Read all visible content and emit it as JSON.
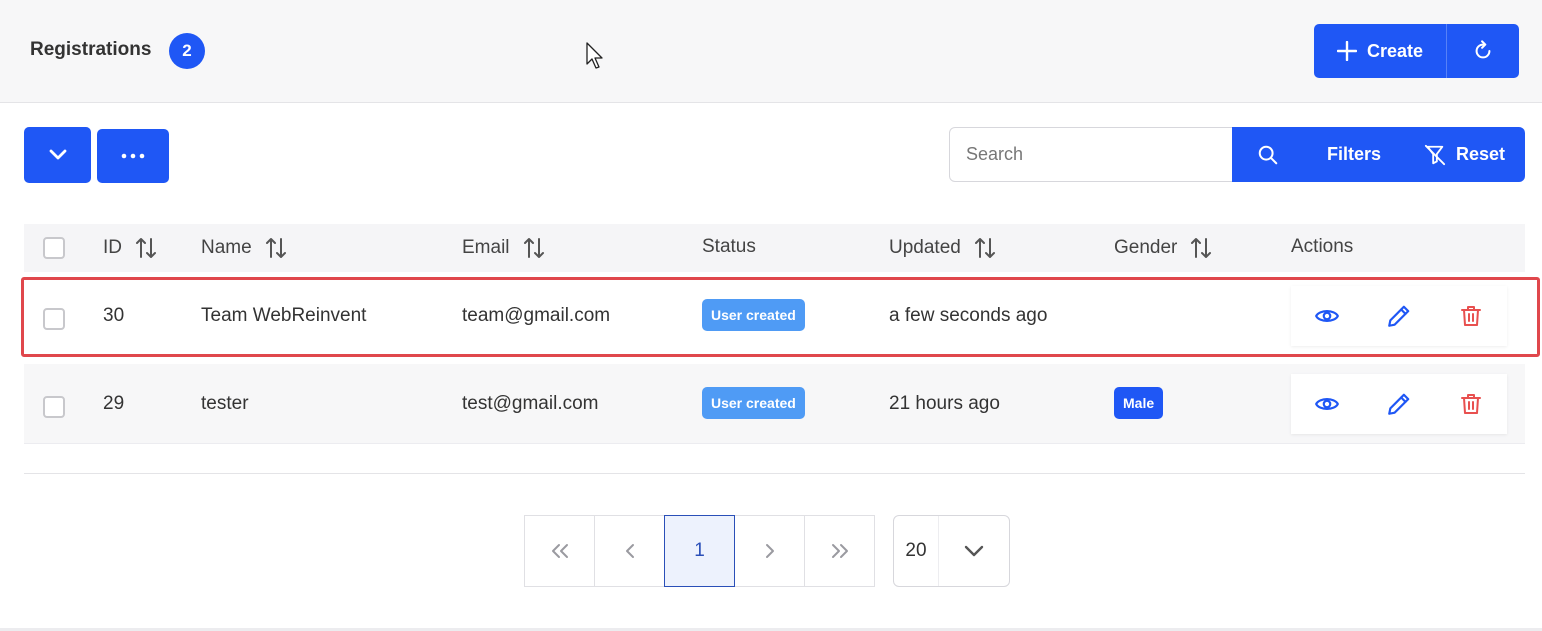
{
  "header": {
    "title": "Registrations",
    "count": "2",
    "create_label": "Create",
    "icons": {
      "create": "plus-icon",
      "refresh": "refresh-icon"
    }
  },
  "toolbar": {
    "search_placeholder": "Search",
    "filters_label": "Filters",
    "reset_label": "Reset",
    "icons": {
      "bulk": "chevron-down-icon",
      "more": "more-dots-icon",
      "search": "search-icon",
      "reset": "filter-off-icon"
    }
  },
  "table": {
    "columns": [
      {
        "label": "ID",
        "sortable": true
      },
      {
        "label": "Name",
        "sortable": true
      },
      {
        "label": "Email",
        "sortable": true
      },
      {
        "label": "Status",
        "sortable": false
      },
      {
        "label": "Updated",
        "sortable": true
      },
      {
        "label": "Gender",
        "sortable": true
      },
      {
        "label": "Actions",
        "sortable": false
      }
    ],
    "rows": [
      {
        "id": "30",
        "name": "Team WebReinvent",
        "email": "team@gmail.com",
        "status": "User created",
        "updated": "a few seconds ago",
        "gender": "",
        "highlighted": true
      },
      {
        "id": "29",
        "name": "tester",
        "email": "test@gmail.com",
        "status": "User created",
        "updated": "21 hours ago",
        "gender": "Male",
        "highlighted": false
      }
    ],
    "action_icons": [
      "eye-icon",
      "pencil-icon",
      "trash-icon"
    ]
  },
  "pagination": {
    "current_page": "1",
    "per_page": "20"
  },
  "colors": {
    "primary": "#1f57f5",
    "status_badge": "#4f9bf5",
    "delete": "#e8504f",
    "highlight_border": "#e0474c"
  }
}
